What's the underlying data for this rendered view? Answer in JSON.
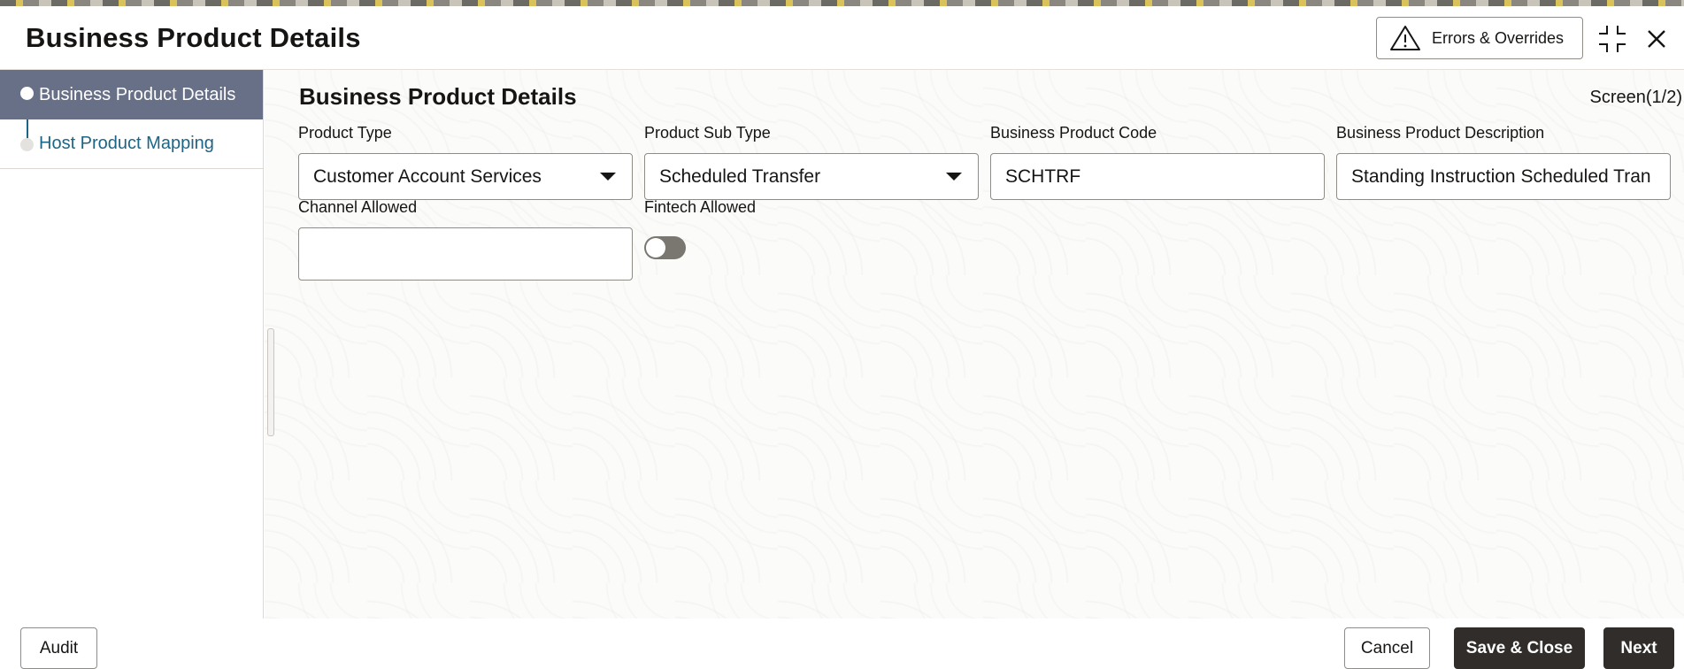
{
  "header": {
    "title": "Business Product Details",
    "errors_button_label": "Errors & Overrides",
    "shrink_icon": "shrink-icon",
    "close_icon": "close-icon"
  },
  "sidebar": {
    "items": [
      {
        "label": "Business Product Details",
        "active": true
      },
      {
        "label": "Host Product Mapping",
        "active": false
      }
    ]
  },
  "main": {
    "section_title": "Business Product Details",
    "screen_indicator": "Screen(1/2)",
    "fields": {
      "product_type": {
        "label": "Product Type",
        "value": "Customer Account Services"
      },
      "product_sub_type": {
        "label": "Product Sub Type",
        "value": "Scheduled Transfer"
      },
      "business_product_code": {
        "label": "Business Product Code",
        "value": "SCHTRF"
      },
      "business_product_description": {
        "label": "Business Product Description",
        "value": "Standing Instruction Scheduled Tran"
      },
      "channel_allowed": {
        "label": "Channel Allowed",
        "value": ""
      },
      "fintech_allowed": {
        "label": "Fintech Allowed",
        "value": false
      }
    }
  },
  "footer": {
    "audit_label": "Audit",
    "cancel_label": "Cancel",
    "save_close_label": "Save & Close",
    "next_label": "Next"
  },
  "colors": {
    "active_nav": "#687087",
    "link": "#1c6587",
    "dark_button": "#312d2a",
    "toggle_off": "#7a7670"
  }
}
